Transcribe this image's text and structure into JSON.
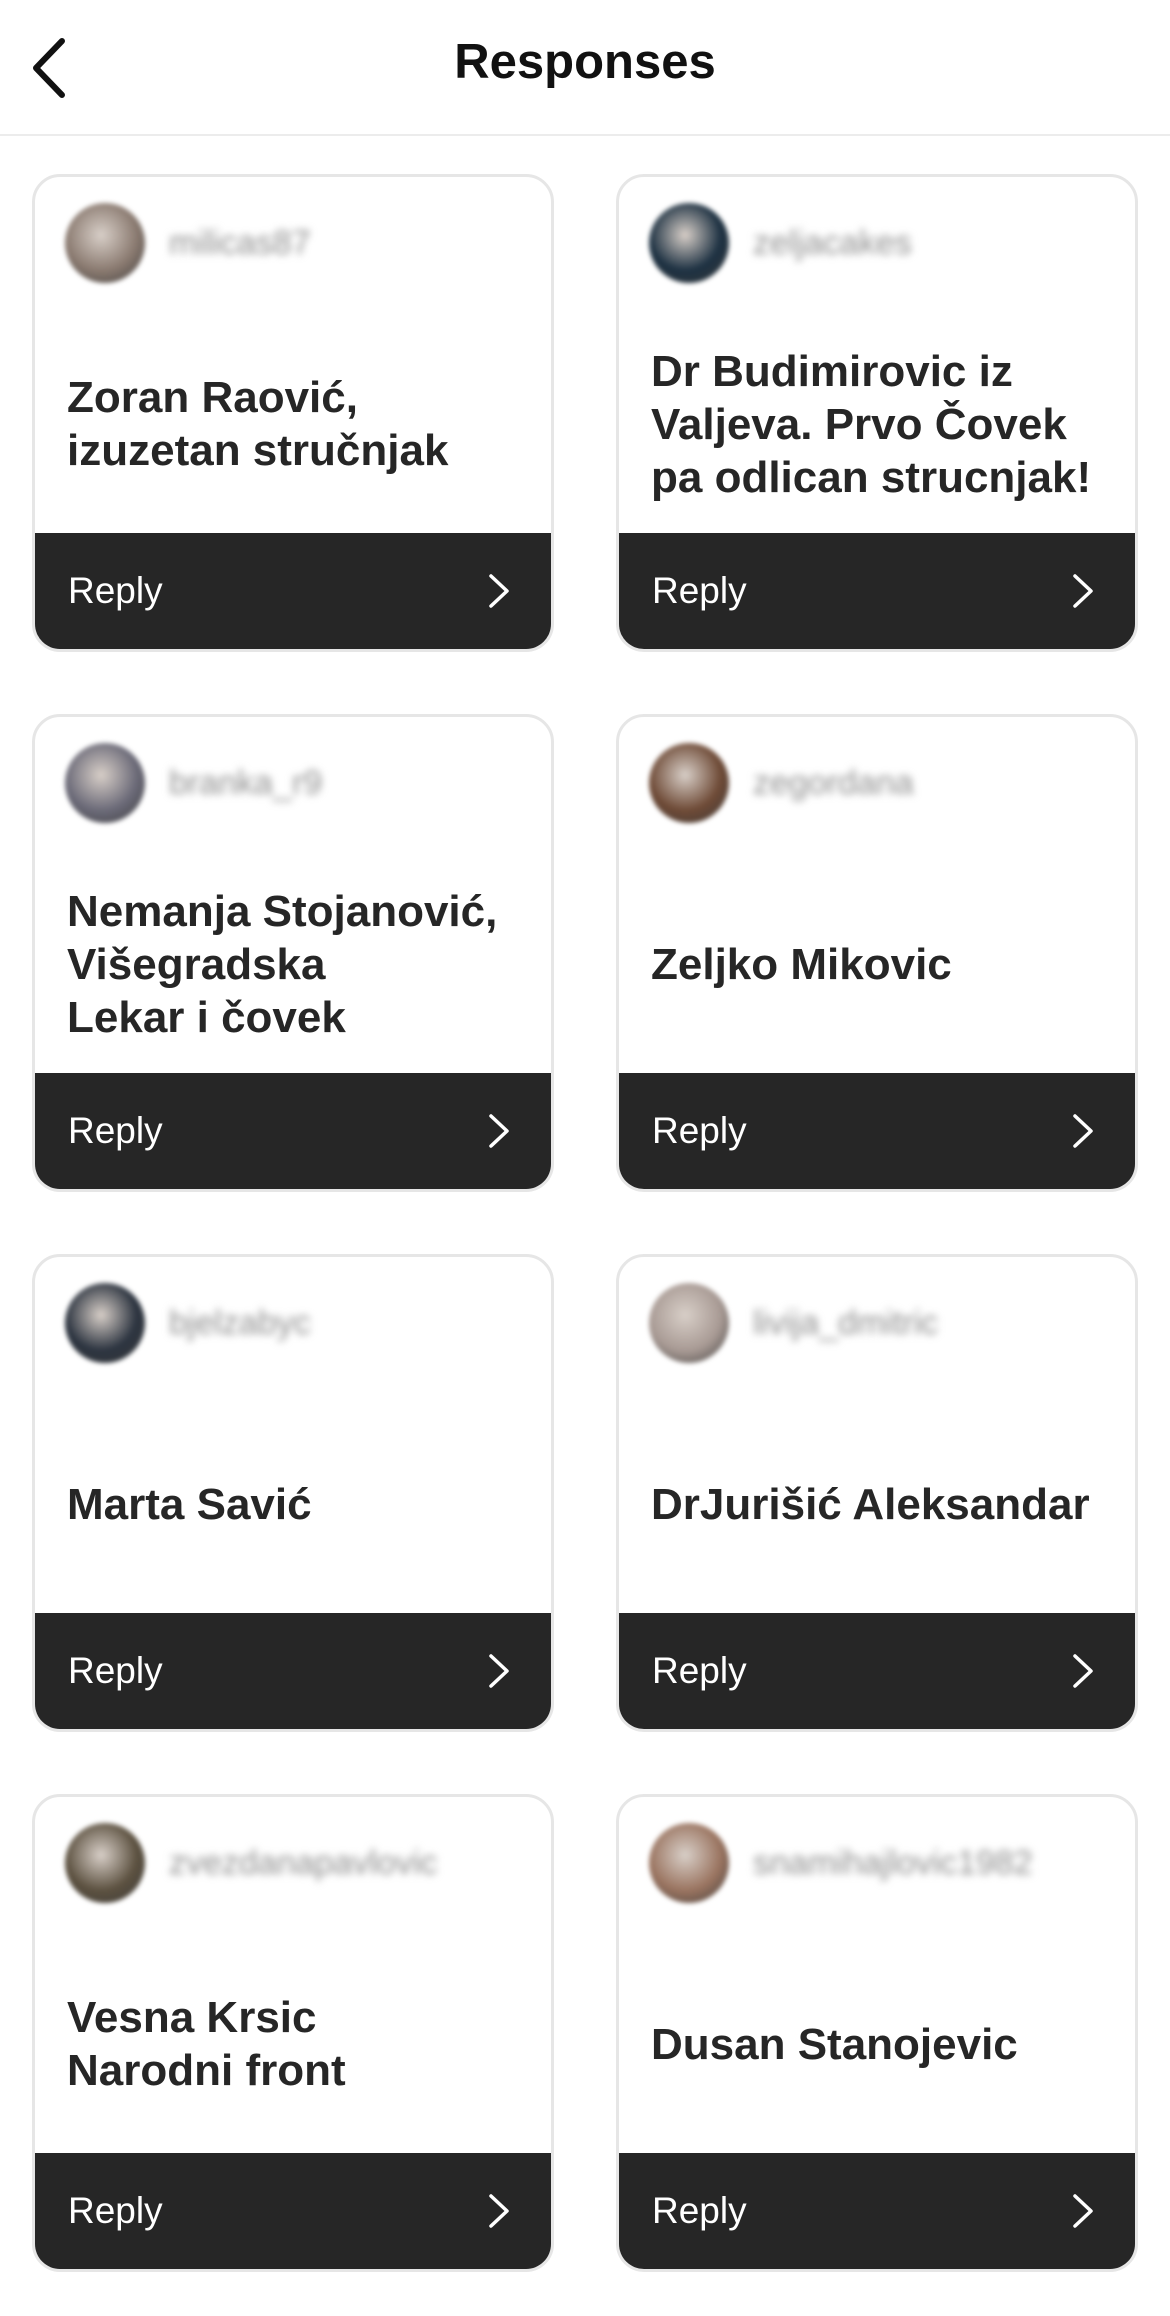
{
  "header": {
    "title": "Responses",
    "back_icon": "chevron-left-icon"
  },
  "cards": [
    {
      "username": "milicas87",
      "text": "Zoran Raović,\nizuzetan stručnjak",
      "reply_label": "Reply",
      "avatar_color": "#8a7a70"
    },
    {
      "username": "zeljacakes",
      "text": "Dr Budimirovic iz\nValjeva. Prvo Čovek\npa odlican strucnjak!",
      "reply_label": "Reply",
      "avatar_color": "#1d3142"
    },
    {
      "username": "branka_r9",
      "text": "Nemanja Stojanović,\nVišegradska\nLekar i čovek",
      "reply_label": "Reply",
      "avatar_color": "#6b6a78"
    },
    {
      "username": "zegordana",
      "text": "Zeljko Mikovic",
      "reply_label": "Reply",
      "avatar_color": "#6e4a36"
    },
    {
      "username": "bjelzabyc",
      "text": "Marta Savić",
      "reply_label": "Reply",
      "avatar_color": "#2c3440"
    },
    {
      "username": "livija_dmitric",
      "text": "DrJurišić Aleksandar",
      "reply_label": "Reply",
      "avatar_color": "#a89a94"
    },
    {
      "username": "zvezdanapavlovic",
      "text": "Vesna Krsic\nNarodni front",
      "reply_label": "Reply",
      "avatar_color": "#5c5140"
    },
    {
      "username": "snamihajlovic1982",
      "text": "Dusan Stanojevic",
      "reply_label": "Reply",
      "avatar_color": "#9a7460"
    }
  ],
  "colors": {
    "reply_bar": "#262626",
    "card_border": "#e6e6e6"
  }
}
